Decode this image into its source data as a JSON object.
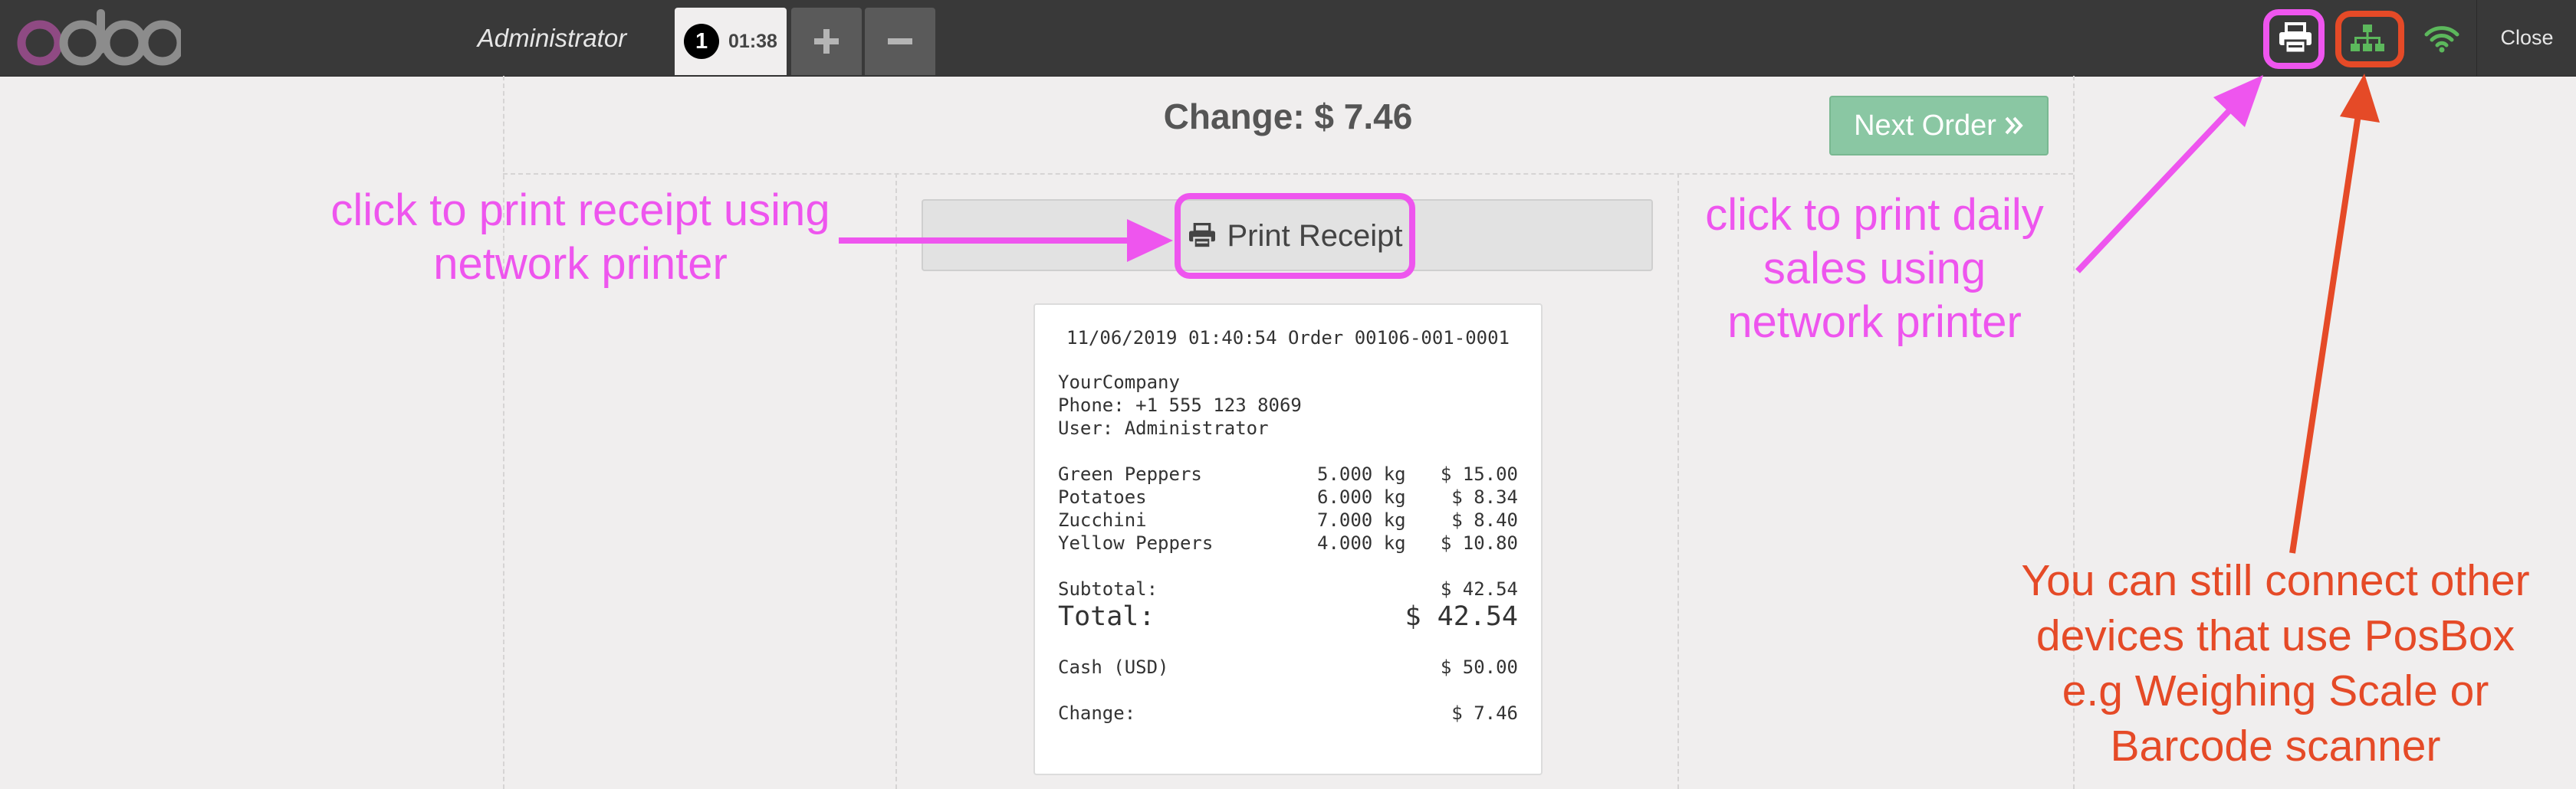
{
  "header": {
    "logo_alt": "odoo",
    "cashier": "Administrator",
    "order_tab": {
      "number": "1",
      "time": "01:38"
    },
    "add_order_label": "+",
    "remove_order_label": "−",
    "close_label": "Close",
    "icons": {
      "printer": "printer-icon",
      "network": "sitemap-icon",
      "wifi": "wifi-icon"
    }
  },
  "screen": {
    "change_title": "Change: $ 7.46",
    "next_order_label": "Next Order",
    "print_receipt_label": "Print Receipt"
  },
  "receipt": {
    "header_line": "11/06/2019 01:40:54 Order 00106-001-0001",
    "company": "YourCompany",
    "phone": "Phone: +1 555 123 8069",
    "user": "User: Administrator",
    "lines": [
      {
        "product": "Green Peppers",
        "qty": "5.000 kg",
        "price": "$ 15.00"
      },
      {
        "product": "Potatoes",
        "qty": "6.000 kg",
        "price": "$ 8.34"
      },
      {
        "product": "Zucchini",
        "qty": "7.000 kg",
        "price": "$ 8.40"
      },
      {
        "product": "Yellow Peppers",
        "qty": "4.000 kg",
        "price": "$ 10.80"
      }
    ],
    "subtotal_label": "Subtotal:",
    "subtotal_value": "$ 42.54",
    "total_label": "Total:",
    "total_value": "$ 42.54",
    "payment_label": "Cash (USD)",
    "payment_value": "$ 50.00",
    "change_label": "Change:",
    "change_value": "$ 7.46"
  },
  "annotations": {
    "receipt_print": [
      "click to print receipt using",
      "network printer"
    ],
    "daily_sales": [
      "click to print daily",
      "sales using",
      "network printer"
    ],
    "posbox": [
      "You can still connect other",
      "devices that use PosBox",
      "e.g Weighing Scale or",
      "Barcode scanner"
    ]
  },
  "colors": {
    "topbar": "#393939",
    "background": "#f0eeee",
    "next_order": "#8ac7a3",
    "annotation_pink": "#ee55ee",
    "annotation_red": "#e54a27",
    "network_status": "#5cb85c"
  }
}
